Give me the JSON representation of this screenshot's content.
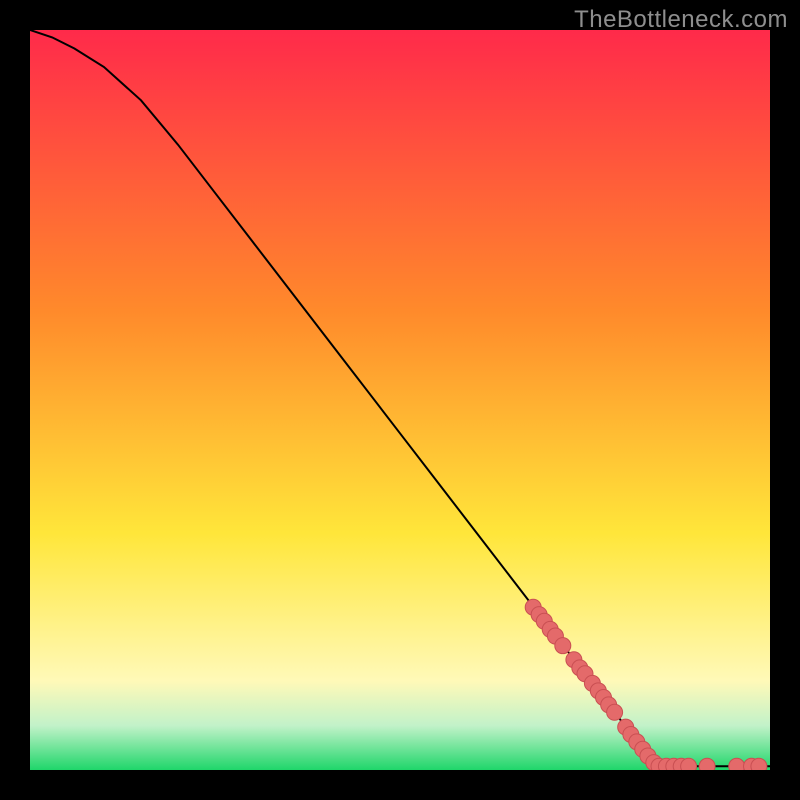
{
  "watermark": "TheBottleneck.com",
  "colors": {
    "background": "#000000",
    "gradient_top": "#ff2a4a",
    "gradient_mid_orange": "#ff8a2b",
    "gradient_yellow": "#ffe63a",
    "gradient_pale_yellow": "#fff9b8",
    "gradient_pale_green": "#c2f2c9",
    "gradient_green": "#1fd66a",
    "curve": "#000000",
    "marker_fill": "#e46a6a",
    "marker_stroke": "#c94f52"
  },
  "chart_data": {
    "type": "line",
    "title": "",
    "xlabel": "",
    "ylabel": "",
    "xlim": [
      0,
      100
    ],
    "ylim": [
      0,
      100
    ],
    "curve": [
      {
        "x": 0,
        "y": 100
      },
      {
        "x": 3,
        "y": 99
      },
      {
        "x": 6,
        "y": 97.5
      },
      {
        "x": 10,
        "y": 95
      },
      {
        "x": 15,
        "y": 90.5
      },
      {
        "x": 20,
        "y": 84.5
      },
      {
        "x": 25,
        "y": 78
      },
      {
        "x": 30,
        "y": 71.5
      },
      {
        "x": 35,
        "y": 65
      },
      {
        "x": 40,
        "y": 58.5
      },
      {
        "x": 45,
        "y": 52
      },
      {
        "x": 50,
        "y": 45.5
      },
      {
        "x": 55,
        "y": 39
      },
      {
        "x": 60,
        "y": 32.5
      },
      {
        "x": 65,
        "y": 26
      },
      {
        "x": 70,
        "y": 19.5
      },
      {
        "x": 75,
        "y": 13
      },
      {
        "x": 80,
        "y": 6.5
      },
      {
        "x": 84,
        "y": 1.2
      },
      {
        "x": 85,
        "y": 0.5
      },
      {
        "x": 90,
        "y": 0.5
      },
      {
        "x": 95,
        "y": 0.5
      },
      {
        "x": 100,
        "y": 0.5
      }
    ],
    "markers": [
      {
        "x": 68.0,
        "y": 22.0
      },
      {
        "x": 68.8,
        "y": 21.0
      },
      {
        "x": 69.5,
        "y": 20.1
      },
      {
        "x": 70.3,
        "y": 19.0
      },
      {
        "x": 71.0,
        "y": 18.1
      },
      {
        "x": 72.0,
        "y": 16.8
      },
      {
        "x": 73.5,
        "y": 14.9
      },
      {
        "x": 74.3,
        "y": 13.8
      },
      {
        "x": 75.0,
        "y": 13.0
      },
      {
        "x": 76.0,
        "y": 11.7
      },
      {
        "x": 76.8,
        "y": 10.7
      },
      {
        "x": 77.5,
        "y": 9.8
      },
      {
        "x": 78.2,
        "y": 8.8
      },
      {
        "x": 79.0,
        "y": 7.8
      },
      {
        "x": 80.5,
        "y": 5.8
      },
      {
        "x": 81.2,
        "y": 4.8
      },
      {
        "x": 82.0,
        "y": 3.8
      },
      {
        "x": 82.8,
        "y": 2.8
      },
      {
        "x": 83.5,
        "y": 1.9
      },
      {
        "x": 84.3,
        "y": 1.0
      },
      {
        "x": 85.0,
        "y": 0.5
      },
      {
        "x": 86.0,
        "y": 0.5
      },
      {
        "x": 87.0,
        "y": 0.5
      },
      {
        "x": 88.0,
        "y": 0.5
      },
      {
        "x": 89.0,
        "y": 0.5
      },
      {
        "x": 91.5,
        "y": 0.5
      },
      {
        "x": 95.5,
        "y": 0.5
      },
      {
        "x": 97.5,
        "y": 0.5
      },
      {
        "x": 98.5,
        "y": 0.5
      }
    ]
  }
}
